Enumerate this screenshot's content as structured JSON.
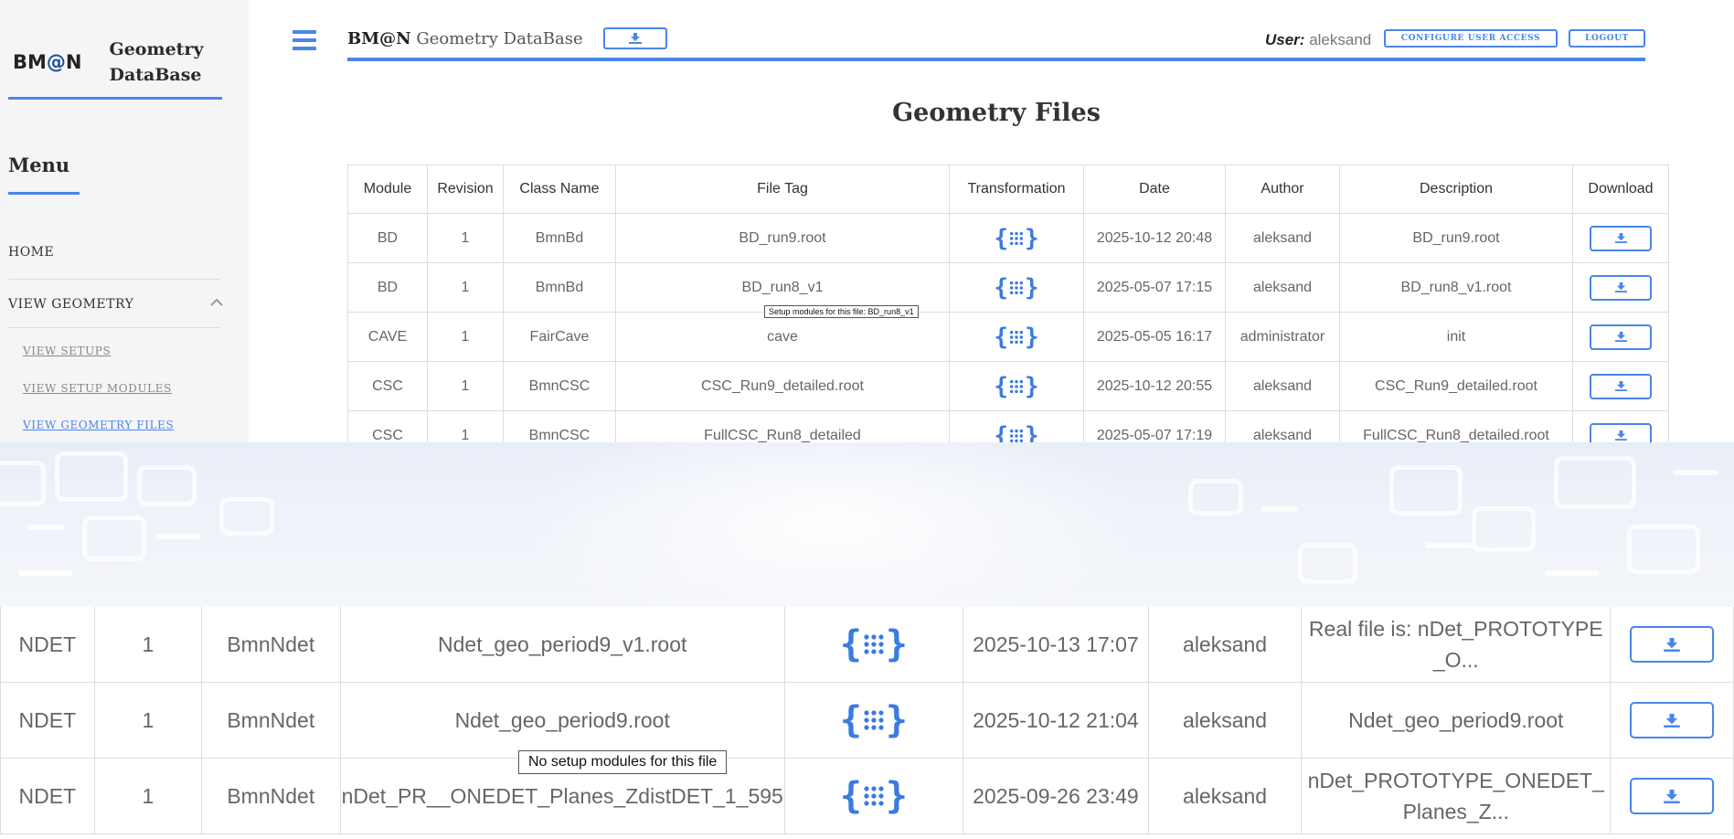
{
  "brand": {
    "logo_text": "BM@N",
    "title_line1": "Geometry",
    "title_line2": "DataBase"
  },
  "sidebar": {
    "menu_title": "Menu",
    "items": [
      {
        "label": "HOME"
      },
      {
        "label": "VIEW GEOMETRY"
      }
    ],
    "subitems": [
      {
        "label": "VIEW SETUPS"
      },
      {
        "label": "VIEW SETUP MODULES"
      },
      {
        "label": "VIEW GEOMETRY FILES",
        "active": true
      }
    ]
  },
  "header": {
    "app_bold": "BM@N",
    "app_rest": "Geometry DataBase",
    "user_label": "User:",
    "user_name": "aleksand",
    "configure_label": "CONFIGURE USER ACCESS",
    "logout_label": "LOGOUT"
  },
  "page_title": "Geometry Files",
  "table": {
    "columns": [
      "Module",
      "Revision",
      "Class Name",
      "File Tag",
      "Transformation",
      "Date",
      "Author",
      "Description",
      "Download"
    ],
    "rows": [
      {
        "module": "BD",
        "revision": "1",
        "class_name": "BmnBd",
        "file_tag": "BD_run9.root",
        "date": "2025-10-12 20:48",
        "author": "aleksand",
        "description": "BD_run9.root"
      },
      {
        "module": "BD",
        "revision": "1",
        "class_name": "BmnBd",
        "file_tag": "BD_run8_v1",
        "date": "2025-05-07 17:15",
        "author": "aleksand",
        "description": "BD_run8_v1.root"
      },
      {
        "module": "CAVE",
        "revision": "1",
        "class_name": "FairCave",
        "file_tag": "cave",
        "date": "2025-05-05 16:17",
        "author": "administrator",
        "description": "init"
      },
      {
        "module": "CSC",
        "revision": "1",
        "class_name": "BmnCSC",
        "file_tag": "CSC_Run9_detailed.root",
        "date": "2025-10-12 20:55",
        "author": "aleksand",
        "description": "CSC_Run9_detailed.root"
      },
      {
        "module": "CSC",
        "revision": "1",
        "class_name": "BmnCSC",
        "file_tag": "FullCSC_Run8_detailed",
        "date": "2025-05-07 17:19",
        "author": "aleksand",
        "description": "FullCSC_Run8_detailed.root"
      }
    ],
    "tooltip": "Setup modules for this file: BD_run8_v1"
  },
  "zoom_table": {
    "rows": [
      {
        "module": "NDET",
        "revision": "1",
        "class_name": "BmnNdet",
        "file_tag": "Ndet_geo_period9_v1.root",
        "date": "2025-10-13 17:07",
        "author": "aleksand",
        "description": "Real file is: nDet_PROTOTYPE _O..."
      },
      {
        "module": "NDET",
        "revision": "1",
        "class_name": "BmnNdet",
        "file_tag": "Ndet_geo_period9.root",
        "date": "2025-10-12 21:04",
        "author": "aleksand",
        "description": "Ndet_geo_period9.root"
      },
      {
        "module": "NDET",
        "revision": "1",
        "class_name": "BmnNdet",
        "file_tag": "nDet_PR__ONEDET_Planes_ZdistDET_1_595",
        "date": "2025-09-26 23:49",
        "author": "aleksand",
        "description": "nDet_PROTOTYPE_ONEDET_ Planes_Z..."
      }
    ],
    "tooltip": "No setup modules for this file"
  },
  "icons": {
    "download": "download-icon",
    "transformation": "braces-grid-icon",
    "menu": "hamburger-icon"
  },
  "colors": {
    "accent": "#4a86e8"
  }
}
